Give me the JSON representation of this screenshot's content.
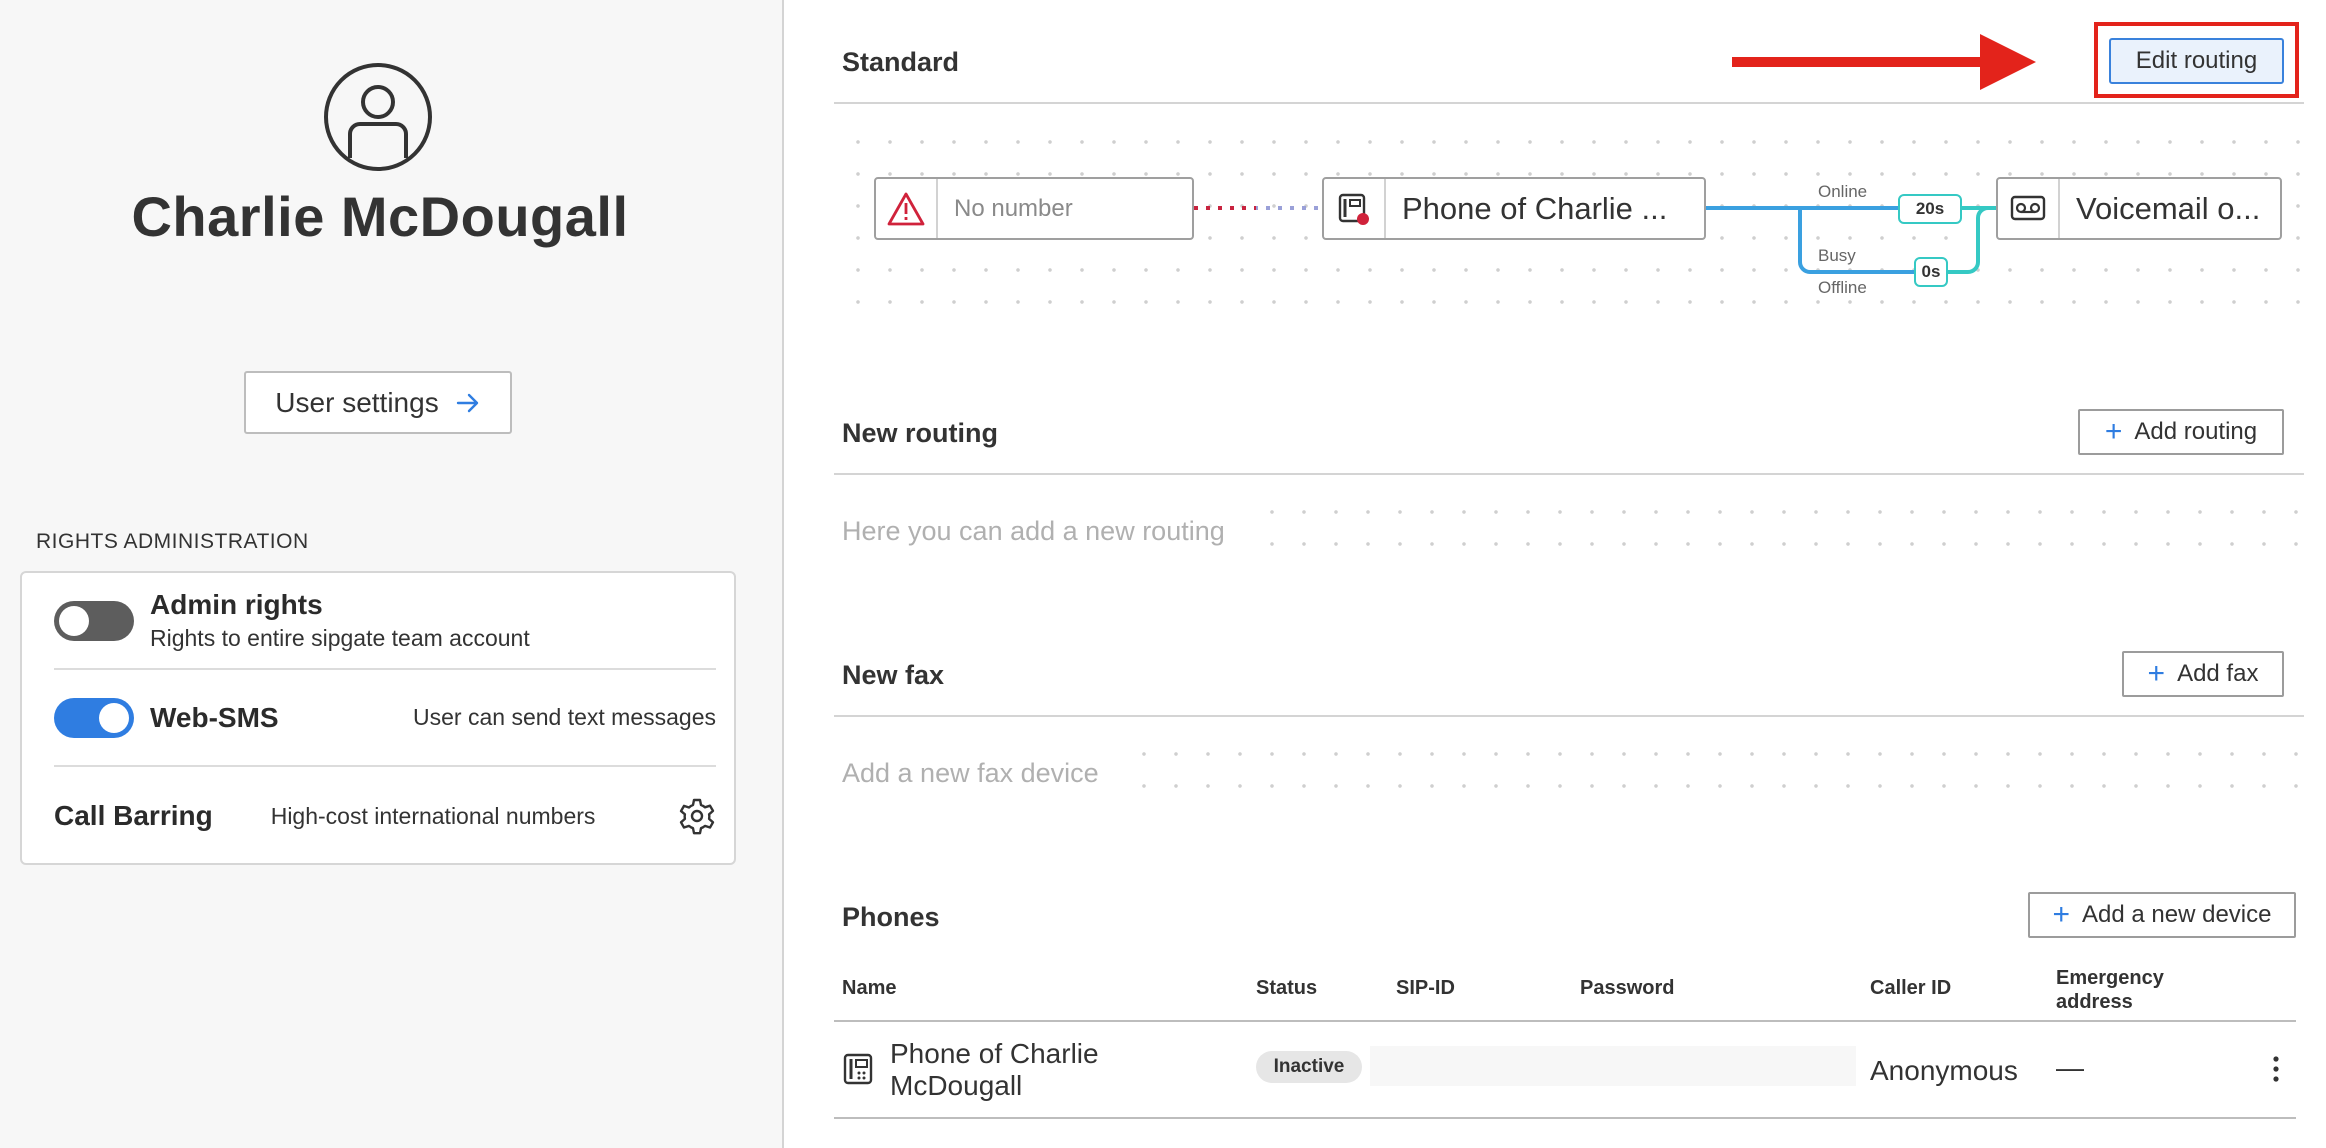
{
  "user": {
    "name": "Charlie McDougall",
    "settings_label": "User settings"
  },
  "rights": {
    "heading": "RIGHTS ADMINISTRATION",
    "admin": {
      "title": "Admin rights",
      "subtitle": "Rights to entire sipgate team account",
      "enabled": false
    },
    "websms": {
      "title": "Web-SMS",
      "description": "User can send text messages",
      "enabled": true
    },
    "call_barring": {
      "title": "Call Barring",
      "description": "High-cost international numbers"
    }
  },
  "standard": {
    "title": "Standard",
    "edit_label": "Edit routing",
    "routing": {
      "source": "No number",
      "device": "Phone of Charlie ...",
      "target": "Voicemail o...",
      "online_label": "Online",
      "online_delay": "20s",
      "busy_label": "Busy",
      "offline_label": "Offline",
      "busy_delay": "0s"
    }
  },
  "new_routing": {
    "title": "New routing",
    "add_label": "Add routing",
    "placeholder": "Here you can add a new routing"
  },
  "new_fax": {
    "title": "New fax",
    "add_label": "Add fax",
    "placeholder": "Add a new fax device"
  },
  "phones": {
    "title": "Phones",
    "add_label": "Add a new device",
    "columns": {
      "name": "Name",
      "status": "Status",
      "sip_id": "SIP-ID",
      "password": "Password",
      "caller_id": "Caller ID",
      "emergency_line1": "Emergency",
      "emergency_line2": "address"
    },
    "rows": [
      {
        "name": "Phone of Charlie McDougall",
        "status": "Inactive",
        "sip_id": "",
        "password": "",
        "caller_id": "Anonymous",
        "emergency": "—"
      }
    ]
  },
  "colors": {
    "accent_blue": "#2f7de1",
    "annotation_red": "#e3231b",
    "route_cyan": "#35c9c4",
    "route_blue": "#3aa0e0"
  },
  "icons": [
    "user-avatar-icon",
    "arrow-right-icon",
    "gear-icon",
    "warning-icon",
    "desk-phone-icon",
    "voicemail-icon",
    "plus-icon",
    "kebab-menu-icon"
  ]
}
